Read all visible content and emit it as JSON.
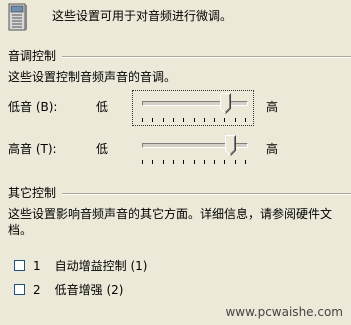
{
  "header": {
    "text": "这些设置可用于对音频进行微调。",
    "icon": "speaker-properties-icon"
  },
  "tone_group": {
    "title": "音调控制",
    "description": "这些设置控制音频声音的音调。",
    "bass": {
      "label": "低音 (B):",
      "min_label": "低",
      "max_label": "高",
      "level": 0.8,
      "ticks": 11
    },
    "treble": {
      "label": "高音 (T):",
      "min_label": "低",
      "max_label": "高",
      "level": 0.85,
      "ticks": 11
    }
  },
  "other_group": {
    "title": "其它控制",
    "description_line1": "这些设置影响音频声音的其它方面。详细信息，请参阅硬件文",
    "description_line2": "档。",
    "options": [
      {
        "number": "1",
        "label": "自动增益控制 (1)",
        "checked": false
      },
      {
        "number": "2",
        "label": "低音增强 (2)",
        "checked": false
      }
    ]
  },
  "watermark": "www.pcwaishe.com",
  "colors": {
    "dialog_bg": "#ece9d8",
    "separator": "#aca899",
    "checkbox_border": "#1c5180"
  }
}
